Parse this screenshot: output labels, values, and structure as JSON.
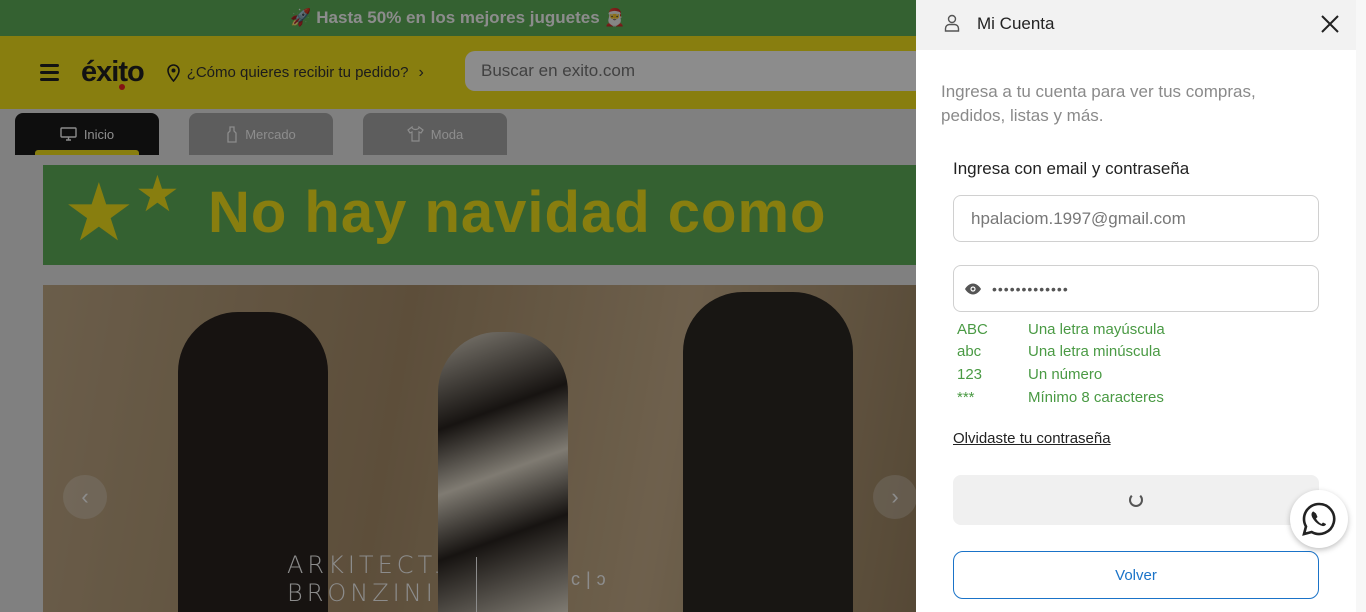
{
  "promo": {
    "text": "🚀 Hasta 50% en los mejores juguetes 🎅"
  },
  "header": {
    "logo": "éxito",
    "delivery_label": "¿Cómo quieres recibir tu pedido?",
    "search_placeholder": "Buscar en exito.com"
  },
  "tabs": [
    {
      "label": "Inicio",
      "icon": "monitor-icon",
      "active": true
    },
    {
      "label": "Mercado",
      "icon": "bottle-icon",
      "active": false
    },
    {
      "label": "Moda",
      "icon": "shirt-icon",
      "active": false
    }
  ],
  "xmas_banner": {
    "text": "No hay navidad como"
  },
  "hero": {
    "brand_line1": "ARKITECT.",
    "brand_line2": "BRONZINI",
    "mark": "c|ɔ"
  },
  "panel": {
    "title": "Mi Cuenta",
    "intro": "Ingresa a tu cuenta para ver tus compras, pedidos, listas y más.",
    "section_label": "Ingresa con email y contraseña",
    "email_value": "hpalaciom.1997@gmail.com",
    "password_masked": "•••••••••••••",
    "rules": [
      {
        "code": "ABC",
        "text": "Una letra mayúscula"
      },
      {
        "code": "abc",
        "text": "Una letra minúscula"
      },
      {
        "code": "123",
        "text": "Un número"
      },
      {
        "code": "***",
        "text": "Mínimo 8 caracteres"
      }
    ],
    "forgot_label": "Olvidaste tu contraseña",
    "back_label": "Volver"
  },
  "colors": {
    "brand_yellow": "#f7e51d",
    "promo_green": "#5fb15a",
    "rule_green": "#4a9a44",
    "link_blue": "#1a73c8"
  }
}
